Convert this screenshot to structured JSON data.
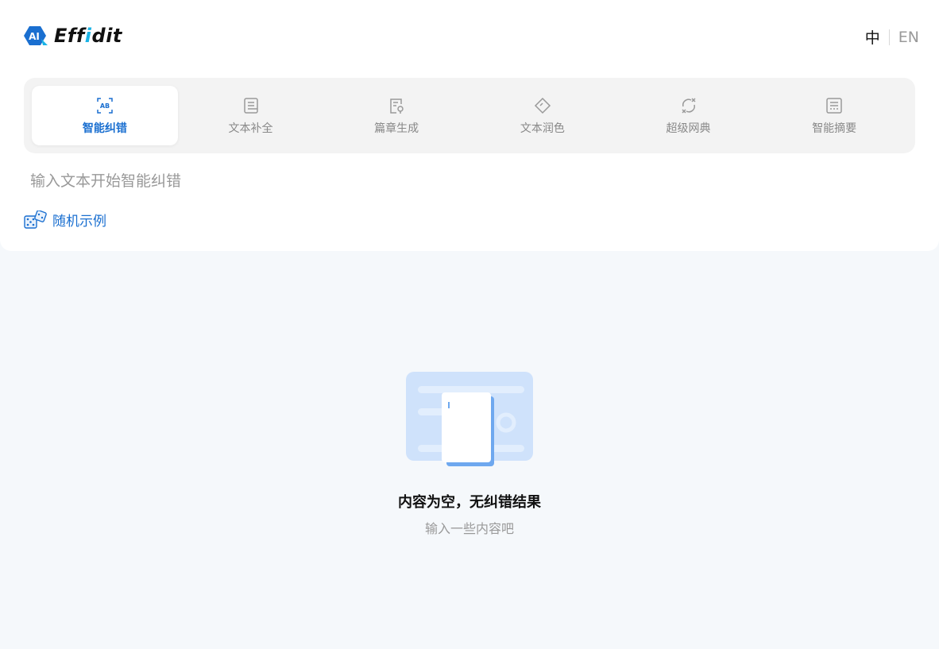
{
  "header": {
    "logo_prefix": "Eff",
    "logo_accent": "i",
    "logo_suffix": "dit",
    "logo_badge": "AI",
    "lang_zh": "中",
    "lang_en": "EN"
  },
  "tabs": [
    {
      "label": "智能纠错",
      "icon": "ab-correction-icon",
      "active": true
    },
    {
      "label": "文本补全",
      "icon": "text-complete-icon",
      "active": false
    },
    {
      "label": "篇章生成",
      "icon": "article-generate-icon",
      "active": false
    },
    {
      "label": "文本润色",
      "icon": "polish-icon",
      "active": false
    },
    {
      "label": "超级网典",
      "icon": "dictionary-icon",
      "active": false
    },
    {
      "label": "智能摘要",
      "icon": "summary-icon",
      "active": false
    }
  ],
  "input": {
    "placeholder": "输入文本开始智能纠错",
    "value": ""
  },
  "random_example": {
    "label": "随机示例",
    "icon": "dice-icon"
  },
  "empty_state": {
    "title": "内容为空，无纠错结果",
    "subtitle": "输入一些内容吧"
  },
  "colors": {
    "accent": "#1a6fd0",
    "background": "#f5f8fb",
    "tab_bar": "#f3f3f3"
  }
}
